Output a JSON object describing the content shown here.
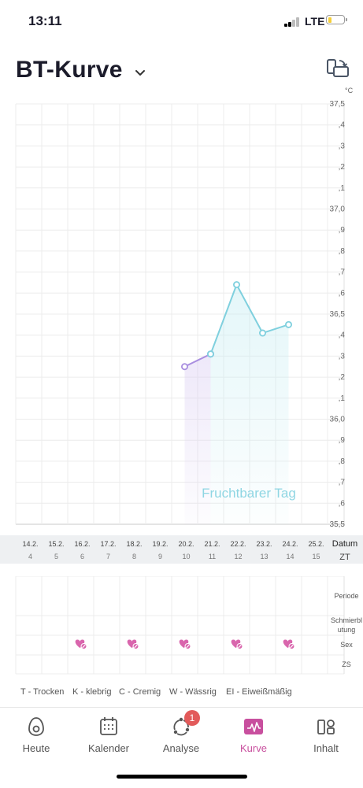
{
  "status_bar": {
    "time": "13:11",
    "network": "LTE"
  },
  "header": {
    "title": "BT-Kurve"
  },
  "chart_data": {
    "type": "line",
    "unit": "°C",
    "y_ticks": [
      "37,5",
      ",4",
      ",3",
      ",2",
      ",1",
      "37,0",
      ",9",
      ",8",
      ",7",
      ",6",
      "36,5",
      ",4",
      ",3",
      ",2",
      ",1",
      "36,0",
      ",9",
      ",8",
      ",7",
      ",6",
      "35,5"
    ],
    "ylim": [
      35.5,
      37.5
    ],
    "dates": [
      "14.2.",
      "15.2.",
      "16.2.",
      "17.2.",
      "18.2.",
      "19.2.",
      "20.2.",
      "21.2.",
      "22.2.",
      "23.2.",
      "24.2.",
      "25.2."
    ],
    "cycle_days": [
      "4",
      "5",
      "6",
      "7",
      "8",
      "9",
      "10",
      "11",
      "12",
      "13",
      "14",
      "15"
    ],
    "date_label": "Datum",
    "cycle_label": "ZT",
    "series": [
      {
        "date_index": [
          6,
          7
        ],
        "values": [
          36.25,
          36.31
        ],
        "color": "#a98ee0"
      },
      {
        "date_index": [
          7,
          8,
          9,
          10
        ],
        "values": [
          36.31,
          36.64,
          36.41,
          36.45
        ],
        "color": "#7fd0de"
      }
    ],
    "fertile_start_index": 6,
    "fertile_end_index": 10,
    "fertile_label": "Fruchtbarer Tag"
  },
  "events": {
    "rows": [
      "Periode",
      "Schmierbl utung",
      "Sex",
      "ZS"
    ],
    "sex_date_indices": [
      2,
      4,
      6,
      8,
      10
    ],
    "heart_color": "#d966ad"
  },
  "legend": [
    "T - Trocken",
    "K - klebrig",
    "C - Cremig",
    "W - Wässrig",
    "EI - Eiweißmäßig"
  ],
  "tabs": [
    {
      "label": "Heute",
      "icon": "egg-icon",
      "active": false
    },
    {
      "label": "Kalender",
      "icon": "calendar-icon",
      "active": false
    },
    {
      "label": "Analyse",
      "icon": "analysis-icon",
      "active": false,
      "badge": "1"
    },
    {
      "label": "Kurve",
      "icon": "curve-icon",
      "active": true
    },
    {
      "label": "Inhalt",
      "icon": "content-icon",
      "active": false
    }
  ]
}
